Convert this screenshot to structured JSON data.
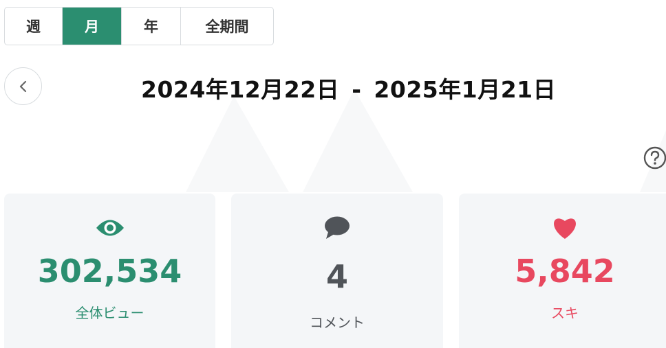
{
  "tabs": [
    {
      "label": "週"
    },
    {
      "label": "月",
      "active": true
    },
    {
      "label": "年"
    },
    {
      "label": "全期間"
    }
  ],
  "date_range": {
    "start": "2024年12月22日",
    "separator": "-",
    "end": "2025年1月21日"
  },
  "stats": [
    {
      "icon": "eye-icon",
      "value": "302,534",
      "label": "全体ビュー",
      "color": "#2b8e70"
    },
    {
      "icon": "comment-icon",
      "value": "4",
      "label": "コメント",
      "color": "#505459"
    },
    {
      "icon": "heart-icon",
      "value": "5,842",
      "label": "スキ",
      "color": "#e8485f"
    }
  ],
  "colors": {
    "accent": "#2b8e70",
    "like": "#e8485f",
    "card_bg": "#f4f6f8",
    "border": "#d8dcdf"
  }
}
